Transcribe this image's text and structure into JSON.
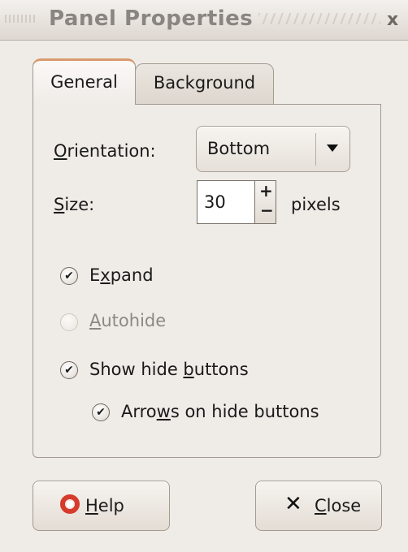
{
  "window": {
    "title": "Panel Properties",
    "close_glyph": "x"
  },
  "tabs": [
    {
      "label": "General",
      "selected": true
    },
    {
      "label": "Background",
      "selected": false
    }
  ],
  "orientation": {
    "label_mnemonic": "O",
    "label_rest": "rientation:",
    "value": "Bottom"
  },
  "size": {
    "label_mnemonic": "S",
    "label_rest": "ize:",
    "value": "30",
    "unit": "pixels",
    "plus_glyph": "+",
    "minus_glyph": "−"
  },
  "options": {
    "expand": {
      "pre": "E",
      "mnemonic": "x",
      "post": "pand",
      "checked": true,
      "enabled": true
    },
    "autohide": {
      "pre": "",
      "mnemonic": "A",
      "post": "utohide",
      "checked": false,
      "enabled": false
    },
    "show_hide_buttons": {
      "pre": "Show hide ",
      "mnemonic": "b",
      "post": "uttons",
      "checked": true,
      "enabled": true
    },
    "arrows_on_hide_buttons": {
      "pre": "Arro",
      "mnemonic": "w",
      "post": "s on hide buttons",
      "checked": true,
      "enabled": true
    }
  },
  "check_glyph": "✔",
  "buttons": {
    "help": {
      "mnemonic": "H",
      "rest": "elp",
      "icon": "lifebuoy-icon"
    },
    "close": {
      "mnemonic": "C",
      "rest": "lose",
      "icon": "close-x-icon"
    }
  },
  "colors": {
    "window_bg": "#efebe7",
    "tab_accent": "#d99a6c",
    "help_icon": "#d63b2c"
  }
}
